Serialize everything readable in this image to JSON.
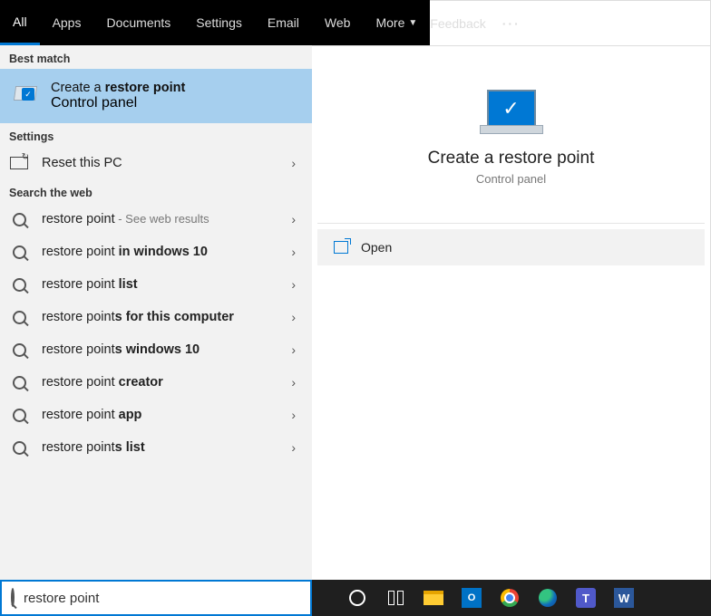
{
  "topbar": {
    "tabs": [
      "All",
      "Apps",
      "Documents",
      "Settings",
      "Email",
      "Web",
      "More"
    ],
    "active": 0,
    "feedback": "Feedback"
  },
  "left": {
    "best_match_header": "Best match",
    "best_match": {
      "title_plain": "Create a ",
      "title_bold": "restore point",
      "subtitle": "Control panel"
    },
    "settings_header": "Settings",
    "settings_item": "Reset this PC",
    "web_header": "Search the web",
    "web": [
      {
        "plain": "restore point",
        "bold": "",
        "suffix": " - See web results"
      },
      {
        "plain": "restore point ",
        "bold": "in windows 10",
        "suffix": ""
      },
      {
        "plain": "restore point ",
        "bold": "list",
        "suffix": ""
      },
      {
        "plain": "restore point",
        "bold": "s for this computer",
        "suffix": ""
      },
      {
        "plain": "restore point",
        "bold": "s windows 10",
        "suffix": ""
      },
      {
        "plain": "restore point ",
        "bold": "creator",
        "suffix": ""
      },
      {
        "plain": "restore point ",
        "bold": "app",
        "suffix": ""
      },
      {
        "plain": "restore point",
        "bold": "s list",
        "suffix": ""
      }
    ]
  },
  "right": {
    "title": "Create a restore point",
    "subtitle": "Control panel",
    "open": "Open"
  },
  "search": {
    "value": "restore point"
  }
}
